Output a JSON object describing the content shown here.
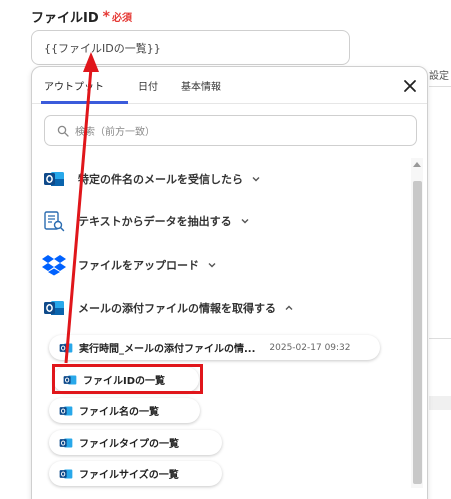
{
  "field": {
    "label": "ファイルID",
    "required_mark": "*",
    "required_text": "必須",
    "value": "{{ファイルIDの一覧}}"
  },
  "background": {
    "right_text": "設定し"
  },
  "panel": {
    "tabs": [
      {
        "label": "アウトプット",
        "active": true
      },
      {
        "label": "日付",
        "active": false
      },
      {
        "label": "基本情報",
        "active": false
      }
    ],
    "search_placeholder": "検索（前方一致）",
    "sections": [
      {
        "label": "特定の件名のメールを受信したら",
        "icon": "outlook-icon",
        "expanded": false
      },
      {
        "label": "テキストからデータを抽出する",
        "icon": "ai-extract-icon",
        "expanded": false
      },
      {
        "label": "ファイルをアップロード",
        "icon": "dropbox-icon",
        "expanded": false
      },
      {
        "label": "メールの添付ファイルの情報を取得する",
        "icon": "outlook-icon",
        "expanded": true
      }
    ],
    "outputs": [
      {
        "label": "実行時間_メールの添付ファイルの情...",
        "value": "2025-02-17 09:32"
      },
      {
        "label": "ファイルIDの一覧"
      },
      {
        "label": "ファイル名の一覧"
      },
      {
        "label": "ファイルタイプの一覧"
      },
      {
        "label": "ファイルサイズの一覧"
      }
    ]
  },
  "colors": {
    "accent": "#3b5bdb",
    "highlight": "#e0161b",
    "required": "#e53935",
    "outlook_blue": "#0a64ad",
    "dropbox_blue": "#0061fe"
  }
}
